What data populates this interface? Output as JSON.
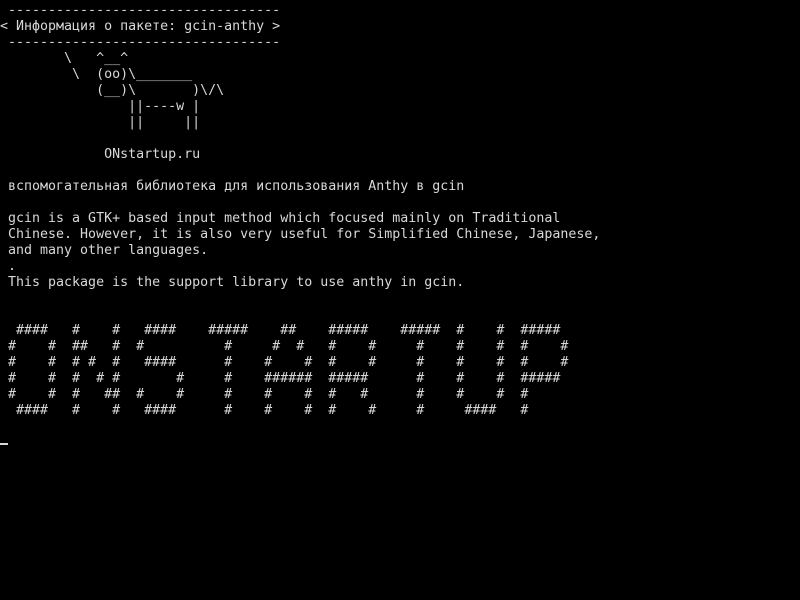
{
  "terminal": {
    "lines": [
      " ----------------------------------",
      "< Информация о пакете: gcin-anthy >",
      " ----------------------------------",
      "        \\   ^__^",
      "         \\  (oo)\\_______",
      "            (__)\\       )\\/\\",
      "                ||----w |",
      "                ||     ||",
      "",
      "             ONstartup.ru",
      "",
      " вспомогательная библиотека для использования Anthy в gcin",
      "",
      " gcin is a GTK+ based input method which focused mainly on Traditional",
      " Chinese. However, it is also very useful for Simplified Chinese, Japanese,",
      " and many other languages.",
      " .",
      " This package is the support library to use anthy in gcin.",
      "",
      "",
      "  ####   #    #   ####    #####    ##    #####    #####  #    #  #####",
      " #    #  ##   #  #          #     #  #   #    #     #    #    #  #    #",
      " #    #  # #  #   ####      #    #    #  #    #     #    #    #  #    #",
      " #    #  #  # #       #     #    ######  #####      #    #    #  #####",
      " #    #  #   ##  #    #     #    #    #  #   #      #    #    #  #",
      "  ####   #    #   ####      #    #    #  #    #     #     ####   #"
    ]
  }
}
